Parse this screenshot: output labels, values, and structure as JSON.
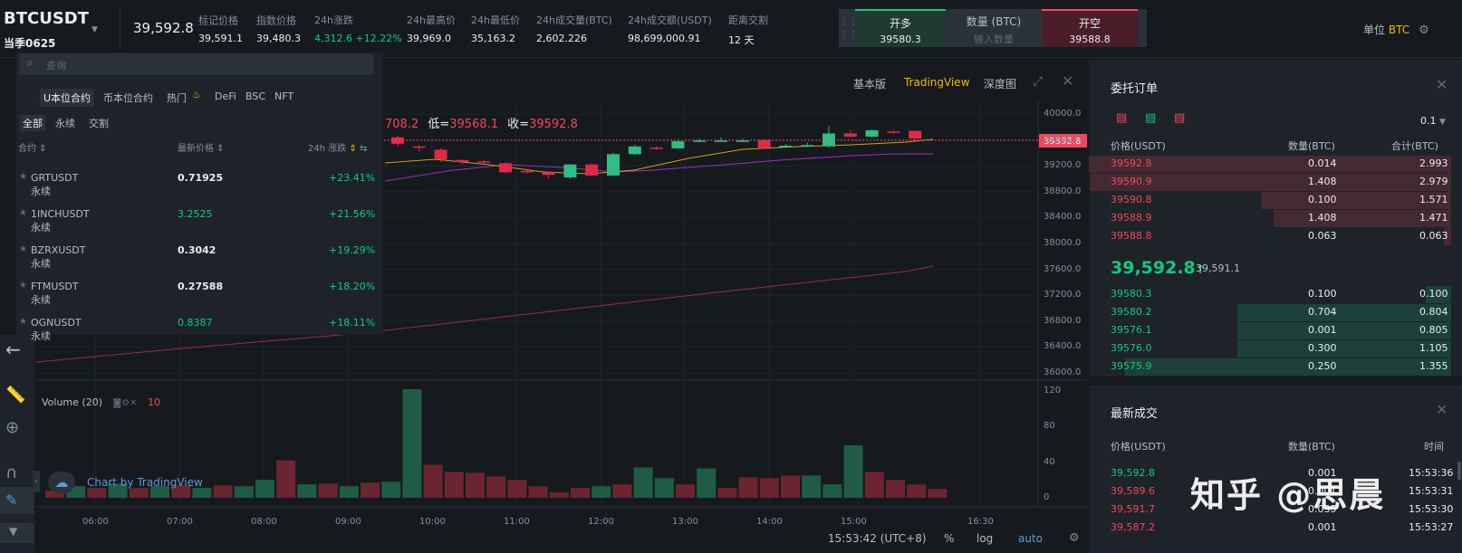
{
  "header": {
    "symbol": "BTCUSDT",
    "contract": "当季0625",
    "last_price": "39,592.8",
    "stats": [
      {
        "label": "标记价格",
        "value": "39,591.1"
      },
      {
        "label": "指数价格",
        "value": "39,480.3"
      },
      {
        "label": "24h涨跌",
        "value": "4,312.6 +12.22%"
      },
      {
        "label": "24h最高价",
        "value": "39,969.0"
      },
      {
        "label": "24h最低价",
        "value": "35,163.2"
      },
      {
        "label": "24h成交量(BTC)",
        "value": "2,602.226"
      },
      {
        "label": "24h成交额(USDT)",
        "value": "98,699,000.91"
      },
      {
        "label": "距离交割",
        "value": "12 天"
      }
    ],
    "quick_trade": {
      "long_label": "开多",
      "long_price": "39580.3",
      "qty_label": "数量 (BTC)",
      "qty_placeholder": "输入数量",
      "short_label": "开空",
      "short_price": "39588.8"
    },
    "unit_label": "单位",
    "unit_value": "BTC"
  },
  "chart_toolbar": {
    "basic": "基本版",
    "tradingview": "TradingView",
    "depth": "深度图"
  },
  "market": {
    "search_placeholder": "查询",
    "tabs": [
      "U本位合约",
      "币本位合约",
      "热门",
      "DeFi",
      "BSC",
      "NFT"
    ],
    "subtabs": [
      "全部",
      "永续",
      "交割"
    ],
    "columns": {
      "symbol": "合约",
      "price": "最新价格",
      "change": "24h 涨跌"
    },
    "rows": [
      {
        "symbol": "GRTUSDT 永续",
        "price": "0.71925",
        "change": "+23.41%",
        "price_up": false
      },
      {
        "symbol": "1INCHUSDT 永续",
        "price": "3.2525",
        "change": "+21.56%",
        "price_up": true
      },
      {
        "symbol": "BZRXUSDT 永续",
        "price": "0.3042",
        "change": "+19.29%",
        "price_up": false
      },
      {
        "symbol": "FTMUSDT 永续",
        "price": "0.27588",
        "change": "+18.20%",
        "price_up": false
      },
      {
        "symbol": "OGNUSDT 永续",
        "price": "0.8387",
        "change": "+18.11%",
        "price_up": true
      }
    ]
  },
  "chart": {
    "ohlc_fragment": "708.2",
    "low_label": "低=",
    "low_value": "39568.1",
    "close_label": "收=",
    "close_value": "39592.8",
    "price_tag": "39592.8",
    "price_ticks": [
      "40000.0",
      "39600.0",
      "39200.0",
      "38800.0",
      "38400.0",
      "38000.0",
      "37600.0",
      "37200.0",
      "36800.0",
      "36400.0",
      "36000.0"
    ],
    "volume_label": "Volume (20)",
    "volume_ma": "10",
    "volume_ticks": [
      "120",
      "80",
      "40",
      "0"
    ],
    "time_ticks": [
      "06:00",
      "07:00",
      "08:00",
      "09:00",
      "10:00",
      "11:00",
      "12:00",
      "13:00",
      "14:00",
      "15:00",
      "16:30"
    ],
    "clock": "15:53:42 (UTC+8)",
    "opt_percent": "%",
    "opt_log": "log",
    "opt_auto": "auto",
    "brand": "Chart by TradingView",
    "candles": [
      {
        "o": 39640,
        "c": 39540,
        "h": 39670,
        "l": 39500
      },
      {
        "o": 39500,
        "c": 39480,
        "h": 39520,
        "l": 39420
      },
      {
        "o": 39450,
        "c": 39300,
        "h": 39470,
        "l": 39260
      },
      {
        "o": 39290,
        "c": 39260,
        "h": 39300,
        "l": 39220
      },
      {
        "o": 39270,
        "c": 39250,
        "h": 39290,
        "l": 39230
      },
      {
        "o": 39240,
        "c": 39100,
        "h": 39250,
        "l": 39080
      },
      {
        "o": 39120,
        "c": 39100,
        "h": 39130,
        "l": 39080
      },
      {
        "o": 39100,
        "c": 39060,
        "h": 39110,
        "l": 39000
      },
      {
        "o": 39020,
        "c": 39220,
        "h": 39230,
        "l": 39000
      },
      {
        "o": 39220,
        "c": 39050,
        "h": 39240,
        "l": 39040
      },
      {
        "o": 39050,
        "c": 39380,
        "h": 39400,
        "l": 39040
      },
      {
        "o": 39380,
        "c": 39500,
        "h": 39520,
        "l": 39370
      },
      {
        "o": 39480,
        "c": 39460,
        "h": 39500,
        "l": 39440
      },
      {
        "o": 39470,
        "c": 39580,
        "h": 39600,
        "l": 39460
      },
      {
        "o": 39580,
        "c": 39590,
        "h": 39620,
        "l": 39560
      },
      {
        "o": 39580,
        "c": 39590,
        "h": 39640,
        "l": 39570
      },
      {
        "o": 39590,
        "c": 39590,
        "h": 39620,
        "l": 39580
      },
      {
        "o": 39600,
        "c": 39480,
        "h": 39620,
        "l": 39470
      },
      {
        "o": 39500,
        "c": 39510,
        "h": 39540,
        "l": 39490
      },
      {
        "o": 39510,
        "c": 39520,
        "h": 39560,
        "l": 39490
      },
      {
        "o": 39500,
        "c": 39700,
        "h": 39820,
        "l": 39480
      },
      {
        "o": 39700,
        "c": 39650,
        "h": 39760,
        "l": 39640
      },
      {
        "o": 39650,
        "c": 39750,
        "h": 39760,
        "l": 39640
      },
      {
        "o": 39730,
        "c": 39720,
        "h": 39760,
        "l": 39700
      },
      {
        "o": 39740,
        "c": 39620,
        "h": 39750,
        "l": 39600
      }
    ],
    "volumes": [
      {
        "v": 8,
        "up": false
      },
      {
        "v": 13,
        "up": true
      },
      {
        "v": 11,
        "up": false
      },
      {
        "v": 16,
        "up": true
      },
      {
        "v": 11,
        "up": false
      },
      {
        "v": 13,
        "up": true
      },
      {
        "v": 14,
        "up": false
      },
      {
        "v": 11,
        "up": true
      },
      {
        "v": 14,
        "up": false
      },
      {
        "v": 13,
        "up": true
      },
      {
        "v": 20,
        "up": true
      },
      {
        "v": 42,
        "up": false
      },
      {
        "v": 15,
        "up": true
      },
      {
        "v": 16,
        "up": false
      },
      {
        "v": 13,
        "up": true
      },
      {
        "v": 17,
        "up": false
      },
      {
        "v": 18,
        "up": true
      },
      {
        "v": 122,
        "up": true
      },
      {
        "v": 37,
        "up": false
      },
      {
        "v": 29,
        "up": false
      },
      {
        "v": 28,
        "up": false
      },
      {
        "v": 24,
        "up": false
      },
      {
        "v": 20,
        "up": false
      },
      {
        "v": 13,
        "up": false
      },
      {
        "v": 6,
        "up": false
      },
      {
        "v": 11,
        "up": false
      },
      {
        "v": 13,
        "up": true
      },
      {
        "v": 15,
        "up": false
      },
      {
        "v": 34,
        "up": true
      },
      {
        "v": 22,
        "up": true
      },
      {
        "v": 15,
        "up": false
      },
      {
        "v": 33,
        "up": true
      },
      {
        "v": 11,
        "up": false
      },
      {
        "v": 23,
        "up": false
      },
      {
        "v": 22,
        "up": false
      },
      {
        "v": 25,
        "up": false
      },
      {
        "v": 25,
        "up": true
      },
      {
        "v": 15,
        "up": true
      },
      {
        "v": 59,
        "up": true
      },
      {
        "v": 29,
        "up": false
      },
      {
        "v": 20,
        "up": false
      },
      {
        "v": 15,
        "up": false
      },
      {
        "v": 10,
        "up": false
      }
    ]
  },
  "orderbook": {
    "title": "委托订单",
    "precision": "0.1",
    "columns": [
      "价格(USDT)",
      "数量(BTC)",
      "合计(BTC)"
    ],
    "asks": [
      {
        "price": "39592.8",
        "qty": "0.014",
        "total": "2.993",
        "depth": 1.0
      },
      {
        "price": "39590.9",
        "qty": "1.408",
        "total": "2.979",
        "depth": 0.995
      },
      {
        "price": "39590.8",
        "qty": "0.100",
        "total": "1.571",
        "depth": 0.525
      },
      {
        "price": "39588.9",
        "qty": "1.408",
        "total": "1.471",
        "depth": 0.49
      },
      {
        "price": "39588.8",
        "qty": "0.063",
        "total": "0.063",
        "depth": 0.02
      }
    ],
    "mid_price": "39,592.8",
    "mid_arrow": "↑",
    "mid_mark": "39,591.1",
    "bids": [
      {
        "price": "39580.3",
        "qty": "0.100",
        "total": "0.100",
        "depth": 0.07
      },
      {
        "price": "39580.2",
        "qty": "0.704",
        "total": "0.804",
        "depth": 0.59
      },
      {
        "price": "39576.1",
        "qty": "0.001",
        "total": "0.805",
        "depth": 0.59
      },
      {
        "price": "39576.0",
        "qty": "0.300",
        "total": "1.105",
        "depth": 0.59
      },
      {
        "price": "39575.9",
        "qty": "0.250",
        "total": "1.355",
        "depth": 0.9
      }
    ]
  },
  "trades": {
    "title": "最新成交",
    "columns": [
      "价格(USDT)",
      "数量(BTC)",
      "时间"
    ],
    "rows": [
      {
        "price": "39,592.8",
        "qty": "0.001",
        "time": "15:53:36",
        "side": "buy"
      },
      {
        "price": "39,589.6",
        "qty": "0.001",
        "time": "15:53:31",
        "side": "sell"
      },
      {
        "price": "39,591.7",
        "qty": "0.035",
        "time": "15:53:30",
        "side": "sell"
      },
      {
        "price": "39,587.2",
        "qty": "0.001",
        "time": "15:53:27",
        "side": "sell"
      }
    ]
  },
  "watermark": "知乎 @思晨"
}
